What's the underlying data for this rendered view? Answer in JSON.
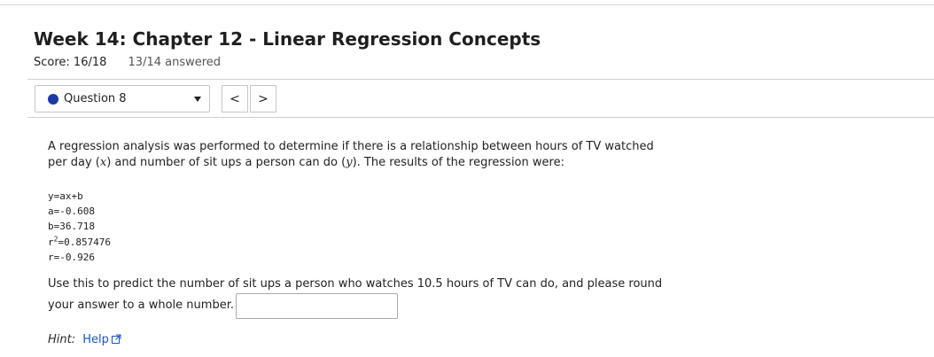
{
  "header": {
    "title": "Week 14: Chapter 12 - Linear Regression Concepts",
    "score_label": "Score: 16/18",
    "answered": "13/14 answered"
  },
  "nav": {
    "question_label": "Question 8",
    "prev_label": "<",
    "next_label": ">",
    "status_color": "#1a3aa8"
  },
  "question": {
    "intro_a": "A regression analysis was performed to determine if there is a relationship between hours of TV watched per day (",
    "var_x": "x",
    "intro_b": ") and number of sit ups a person can do (",
    "var_y": "y",
    "intro_c": "). The results of the regression were:",
    "results": {
      "equation": "y=ax+b",
      "a": "a=-0.608",
      "b": "b=36.718",
      "r2_prefix": "r",
      "r2_sup": "2",
      "r2_value": "=0.857476",
      "r": "r=-0.926"
    },
    "prompt_line1": "Use this to predict the number of sit ups a person who watches 10.5 hours of TV can do, and please round",
    "prompt_line2": "your answer to a whole number.",
    "answer_value": ""
  },
  "hint": {
    "label": "Hint:",
    "link": "Help",
    "icon": "external-link-icon"
  }
}
